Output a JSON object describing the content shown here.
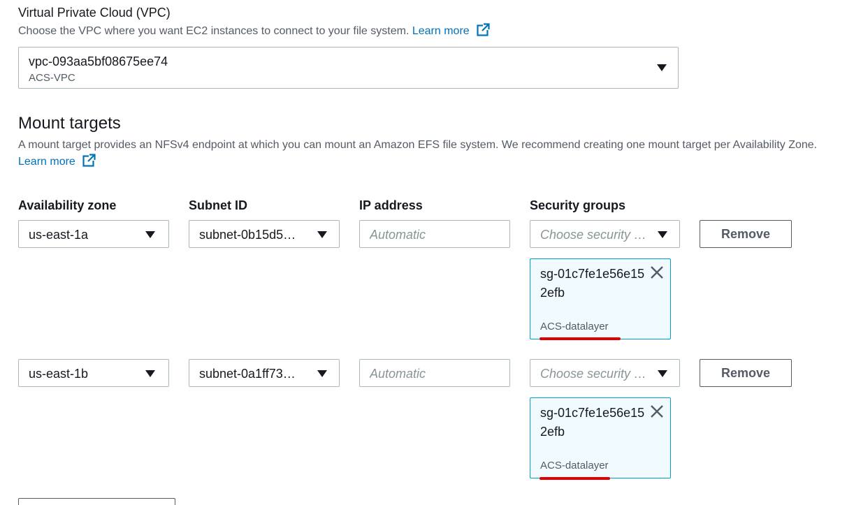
{
  "vpc": {
    "title": "Virtual Private Cloud (VPC)",
    "description": "Choose the VPC where you want EC2 instances to connect to your file system.",
    "learn_more": "Learn more",
    "selected_id": "vpc-093aa5bf08675ee74",
    "selected_name": "ACS-VPC"
  },
  "mount_targets": {
    "heading": "Mount targets",
    "description": "A mount target provides an NFSv4 endpoint at which you can mount an Amazon EFS file system. We recommend creating one mount target per Availability Zone.",
    "learn_more": "Learn more",
    "columns": [
      "Availability zone",
      "Subnet ID",
      "IP address",
      "Security groups"
    ],
    "rows": [
      {
        "az": "us-east-1a",
        "subnet": "subnet-0b15d5…",
        "ip_placeholder": "Automatic",
        "sg_placeholder": "Choose security …",
        "remove": "Remove",
        "token_id": "sg-01c7fe1e56e152efb",
        "token_name": "ACS-datalayer"
      },
      {
        "az": "us-east-1b",
        "subnet": "subnet-0a1ff73…",
        "ip_placeholder": "Automatic",
        "sg_placeholder": "Choose security …",
        "remove": "Remove",
        "token_id": "sg-01c7fe1e56e152efb",
        "token_name": "ACS-datalayer"
      }
    ]
  },
  "colors": {
    "link": "#0073bb",
    "token_border": "#00a1c9",
    "token_bg": "#f1faff",
    "annotation": "#e00000"
  }
}
